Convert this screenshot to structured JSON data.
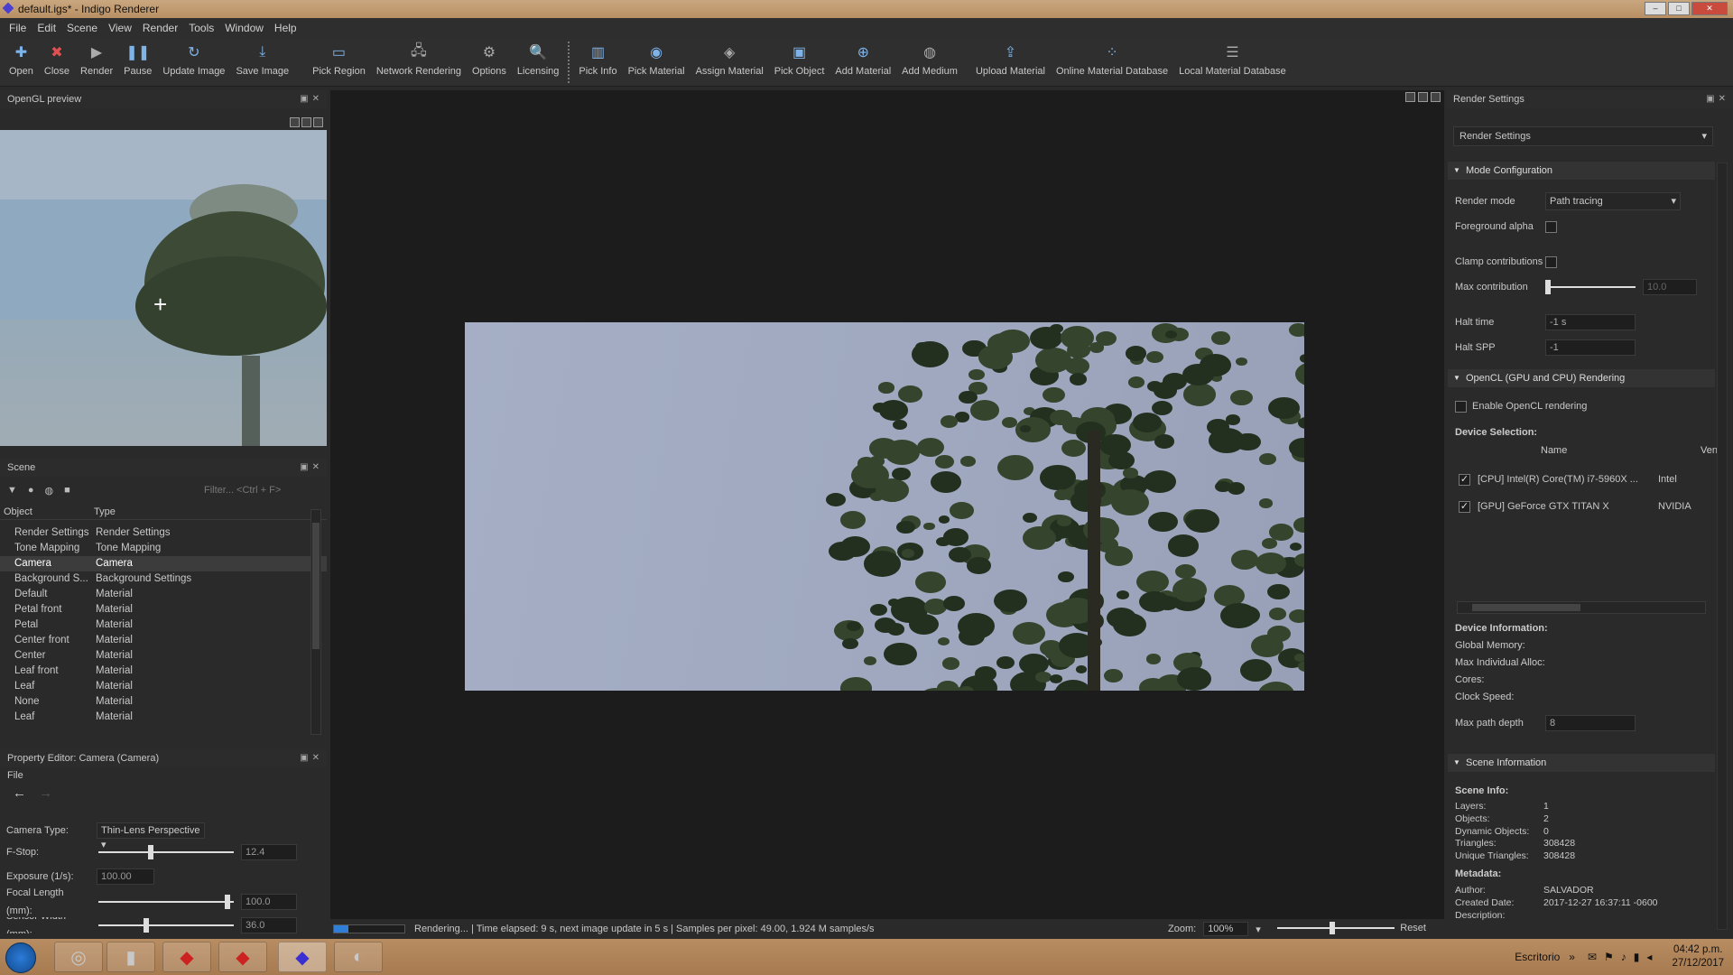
{
  "window": {
    "title": "default.igs* - Indigo Renderer"
  },
  "menu": [
    "File",
    "Edit",
    "Scene",
    "View",
    "Render",
    "Tools",
    "Window",
    "Help"
  ],
  "toolbar": [
    {
      "label": "Open",
      "icon": "plus-icon"
    },
    {
      "label": "Close",
      "icon": "close-icon"
    },
    {
      "label": "Render",
      "icon": "play-icon"
    },
    {
      "label": "Pause",
      "icon": "pause-icon"
    },
    {
      "label": "Update Image",
      "icon": "refresh-icon"
    },
    {
      "label": "Save Image",
      "icon": "download-icon"
    },
    {
      "label": "Pick Region",
      "icon": "region-icon"
    },
    {
      "label": "Network Rendering",
      "icon": "network-icon"
    },
    {
      "label": "Options",
      "icon": "gear-icon"
    },
    {
      "label": "Licensing",
      "icon": "key-icon"
    },
    {
      "label": "Pick Info",
      "icon": "info-chart-icon"
    },
    {
      "label": "Pick Material",
      "icon": "pick-material-icon"
    },
    {
      "label": "Assign Material",
      "icon": "assign-material-icon"
    },
    {
      "label": "Pick Object",
      "icon": "pick-object-icon"
    },
    {
      "label": "Add Material",
      "icon": "add-material-icon"
    },
    {
      "label": "Add Medium",
      "icon": "add-medium-icon"
    },
    {
      "label": "Upload Material",
      "icon": "upload-icon"
    },
    {
      "label": "Online Material Database",
      "icon": "online-database-icon"
    },
    {
      "label": "Local Material Database",
      "icon": "local-database-icon"
    }
  ],
  "opengl": {
    "title": "OpenGL preview"
  },
  "scene": {
    "title": "Scene",
    "filter_placeholder": "Filter... <Ctrl + F>",
    "col_object": "Object",
    "col_type": "Type",
    "rows": [
      [
        "Render Settings",
        "Render Settings"
      ],
      [
        "Tone Mapping",
        "Tone Mapping"
      ],
      [
        "Camera",
        "Camera"
      ],
      [
        "Background S...",
        "Background Settings"
      ],
      [
        "Default",
        "Material"
      ],
      [
        "Petal front",
        "Material"
      ],
      [
        "Petal",
        "Material"
      ],
      [
        "Center front",
        "Material"
      ],
      [
        "Center",
        "Material"
      ],
      [
        "Leaf front",
        "Material"
      ],
      [
        "Leaf",
        "Material"
      ],
      [
        "None",
        "Material"
      ],
      [
        "Leaf",
        "Material"
      ]
    ],
    "selected_index": 2
  },
  "prop": {
    "title": "Property Editor: Camera (Camera)",
    "file": "File",
    "camera_type_label": "Camera Type:",
    "camera_type_value": "Thin-Lens Perspective",
    "fstop_label": "F-Stop:",
    "fstop_value": "12.4",
    "fstop_level": 0.38,
    "exposure_label": "Exposure (1/s):",
    "exposure_value": "100.00",
    "focal_label": "Focal Length (mm):",
    "focal_value": "100.0",
    "focal_level": 0.97,
    "sensor_label": "Sensor Width (mm):",
    "sensor_value": "36.0",
    "sensor_level": 0.35
  },
  "status": {
    "message": "Rendering... | Time elapsed: 9 s, next image update in 5 s | Samples per pixel: 49.00, 1.924 M samples/s",
    "progress": 0.2,
    "zoom_label": "Zoom:",
    "zoom_value": "100%",
    "reset": "Reset"
  },
  "render_settings": {
    "title": "Render Settings",
    "preset": "Render Settings",
    "mode_section": "Mode Configuration",
    "render_mode_label": "Render mode",
    "render_mode_value": "Path tracing",
    "fg_alpha_label": "Foreground alpha",
    "clamp_label": "Clamp contributions",
    "max_contrib_label": "Max contribution",
    "max_contrib_value": "10.0",
    "halt_time_label": "Halt time",
    "halt_time_value": "-1 s",
    "halt_spp_label": "Halt SPP",
    "halt_spp_value": "-1",
    "opencl_section": "OpenCL (GPU and CPU) Rendering",
    "enable_opencl": "Enable OpenCL rendering",
    "device_selection": "Device Selection:",
    "col_name": "Name",
    "col_vendor": "Vend",
    "devices": [
      {
        "name": "[CPU] Intel(R) Core(TM) i7-5960X ...",
        "vendor": "Intel"
      },
      {
        "name": "[GPU] GeForce GTX TITAN X",
        "vendor": "NVIDIA"
      }
    ],
    "device_info": "Device Information:",
    "global_memory": "Global Memory:",
    "max_alloc": "Max Individual Alloc:",
    "cores": "Cores:",
    "clock": "Clock Speed:",
    "max_path_label": "Max path depth",
    "max_path_value": "8",
    "scene_section": "Scene Information",
    "scene_info": "Scene Info:",
    "layers_label": "Layers:",
    "layers": "1",
    "objects_label": "Objects:",
    "objects": "2",
    "dyn_label": "Dynamic Objects:",
    "dyn": "0",
    "tri_label": "Triangles:",
    "tri": "308428",
    "utri_label": "Unique Triangles:",
    "utri": "308428",
    "metadata": "Metadata:",
    "author_label": "Author:",
    "author": "SALVADOR",
    "created_label": "Created Date:",
    "created": "2017-12-27 16:37:11 -0600",
    "desc_label": "Description:"
  },
  "taskbar": {
    "desktop": "Escritorio",
    "time": "04:42 p.m.",
    "date": "27/12/2017"
  }
}
